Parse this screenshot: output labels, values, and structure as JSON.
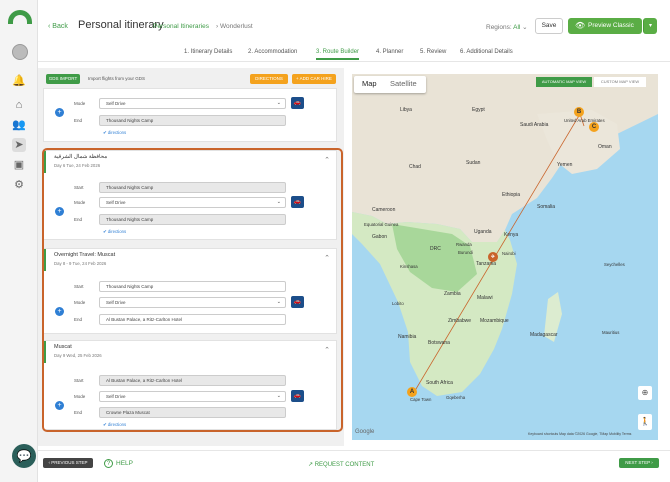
{
  "header": {
    "back_label": "Back",
    "title": "Personal itinerary",
    "crumb_link": "Personal Itineraries",
    "crumb_sep": "›",
    "crumb_current": "Wonderlust",
    "regions_label": "Regions:",
    "regions_value": "All",
    "save_label": "Save",
    "preview_label": "Preview Classic"
  },
  "steps": [
    {
      "label": "1. Itinerary Details"
    },
    {
      "label": "2. Accommodation"
    },
    {
      "label": "3. Route Builder"
    },
    {
      "label": "4. Planner"
    },
    {
      "label": "5. Review"
    },
    {
      "label": "6. Additional Details"
    }
  ],
  "toolbar": {
    "gds_label": "GDS IMPORT",
    "gds_hint": "Import flights from your GDS",
    "directions_label": "DIRECTIONS",
    "car_hire_label": "+ ADD CAR HIRE"
  },
  "route": {
    "labels": {
      "start": "Start",
      "mode": "Mode",
      "end": "End",
      "directions": "directions"
    },
    "first_partial": {
      "mode": "Self Drive",
      "end": "Thousand Nights Camp"
    },
    "cards": [
      {
        "title": "محافظة شمال الشرقية",
        "date": "Day 6 Tue, 24 Feb 2026",
        "start": "Thousand Nights Camp",
        "mode": "Self Drive",
        "end": "Thousand Nights Camp"
      },
      {
        "title": "Overnight Travel: Muscat",
        "date": "Day 8 - 9 Tue, 24 Feb 2026",
        "start": "Thousand Nights Camp",
        "mode": "Self Drive",
        "end": "Al Bustan Palace, a Ritz-Carlton Hotel"
      },
      {
        "title": "Muscat",
        "date": "Day 9 Wed, 25 Feb 2026",
        "start": "Al Bustan Palace, a Ritz-Carlton Hotel",
        "mode": "Self Drive",
        "end": "Crowne Plaza Muscat"
      }
    ]
  },
  "map": {
    "tab_map": "Map",
    "tab_satellite": "Satellite",
    "auto_view": "AUTOMATIC MAP VIEW",
    "custom_view": "CUSTOM MAP VIEW",
    "labels": [
      "Libya",
      "Egypt",
      "Saudi Arabia",
      "Oman",
      "United Arab Emirates",
      "Chad",
      "Sudan",
      "Yemen",
      "Ethiopia",
      "Somalia",
      "Cameroon",
      "Gabon",
      "Equatorial Guinea",
      "DRC",
      "Uganda",
      "Kenya",
      "Rwanda",
      "Burundi",
      "Tanzania",
      "Zambia",
      "Malawi",
      "Zimbabwe",
      "Mozambique",
      "Madagascar",
      "Namibia",
      "Botswana",
      "South Africa",
      "Cape Town",
      "Gqeberha",
      "Seychelles",
      "Mauritius",
      "Nairobi",
      "Lobito",
      "Kinshasa"
    ],
    "markers": [
      "A",
      "B",
      "C"
    ],
    "attribution": "Keyboard shortcuts   Map data ©2026 Google, TMap Mobility   Terms",
    "logo": "Google"
  },
  "footer": {
    "prev_label": "PREVIOUS STEP",
    "help_label": "HELP",
    "request_label": "REQUEST CONTENT",
    "next_label": "NEXT STEP"
  },
  "colors": {
    "brand_green": "#3f9b47",
    "orange": "#f4a21d",
    "frame": "#c9642b",
    "navy": "#1c4e8a"
  }
}
